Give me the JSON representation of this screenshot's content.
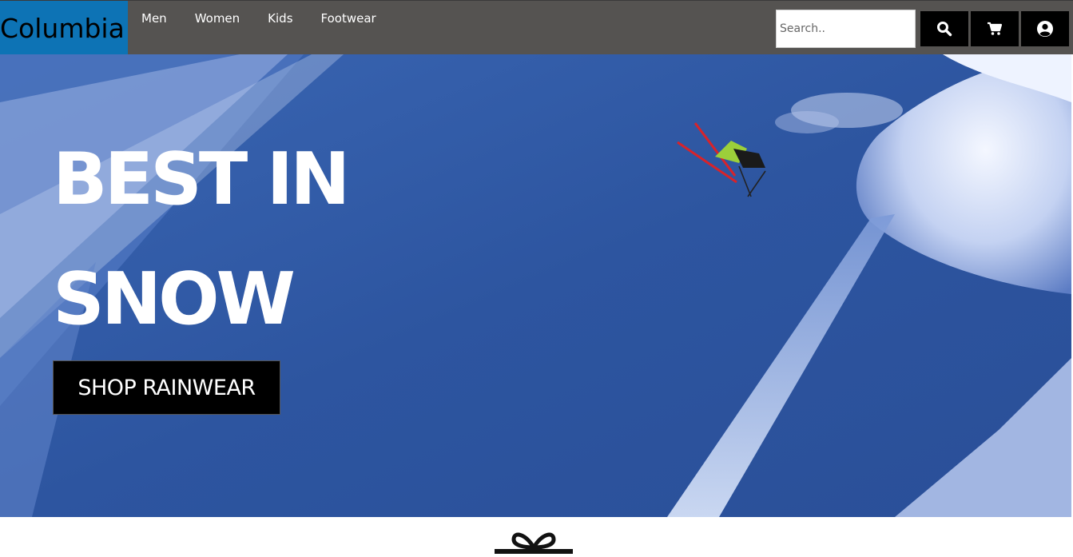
{
  "header": {
    "brand": "Columbia",
    "nav": [
      {
        "label": "Men"
      },
      {
        "label": "Women"
      },
      {
        "label": "Kids"
      },
      {
        "label": "Footwear"
      }
    ],
    "search": {
      "placeholder": "Search..",
      "value": ""
    },
    "icons": {
      "search": "search-icon",
      "cart": "shopping-cart-icon",
      "account": "user-circle-icon"
    }
  },
  "hero": {
    "title": "BEST IN\nSNOW",
    "cta_label": "SHOP RAINWEAR",
    "image": "skier-jumping-over-snow-slope"
  },
  "below_fold": {
    "icon": "gift-icon"
  },
  "colors": {
    "brand_bg": "#0d73b5",
    "navbar_bg": "#555351",
    "hero_blue": "#2f57a0",
    "button_bg": "#000000"
  }
}
